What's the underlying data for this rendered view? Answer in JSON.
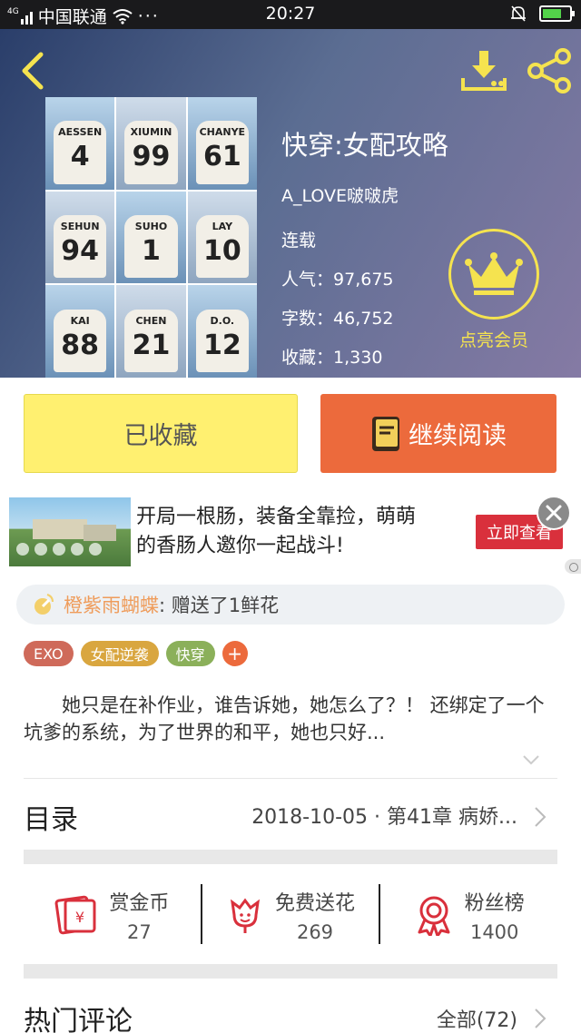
{
  "status_bar": {
    "carrier": "中国联通",
    "network": "4G",
    "time": "20:27"
  },
  "book": {
    "title": "快穿:女配攻略",
    "author": "A_LOVE啵啵虎",
    "status": "连载",
    "popularity_label": "人气",
    "popularity": "97,675",
    "words_label": "字数",
    "words": "46,752",
    "favorites_label": "收藏",
    "favorites": "1,330",
    "cover_jerseys": [
      {
        "name": "AESSEN",
        "no": "4"
      },
      {
        "name": "XIUMIN",
        "no": "99"
      },
      {
        "name": "CHANYE",
        "no": "61"
      },
      {
        "name": "SEHUN",
        "no": "94"
      },
      {
        "name": "SUHO",
        "no": "1"
      },
      {
        "name": "LAY",
        "no": "10"
      },
      {
        "name": "KAI",
        "no": "88"
      },
      {
        "name": "CHEN",
        "no": "21"
      },
      {
        "name": "D.O.",
        "no": "12"
      }
    ]
  },
  "vip": {
    "label": "点亮会员",
    "color": "#f5e34f"
  },
  "actions": {
    "favorited_label": "已收藏",
    "read_label": "继续阅读",
    "read_color": "#ec6a3c",
    "fav_color": "#fff070"
  },
  "ad": {
    "line1": "开局一根肠，装备全靠捡，萌萌",
    "line2": "的香肠人邀你一起战斗!",
    "cta": "立即查看"
  },
  "gift_notice": {
    "user": "橙紫雨蝴蝶",
    "text": ": 赠送了1鲜花"
  },
  "tags": [
    {
      "label": "EXO",
      "color": "#cf6a5a"
    },
    {
      "label": "女配逆袭",
      "color": "#d9a63f"
    },
    {
      "label": "快穿",
      "color": "#8bb05a"
    },
    {
      "label": "+",
      "color": "#ec6a3c"
    }
  ],
  "description": "她只是在补作业，谁告诉她，她怎么了？！ 还绑定了一个坑爹的系统，为了世界的和平，她也只好...",
  "toc": {
    "label": "目录",
    "latest": "2018-10-05 · 第41章  病娇..."
  },
  "stats": [
    {
      "label": "赏金币",
      "value": "27",
      "icon": "red-envelope-icon"
    },
    {
      "label": "免费送花",
      "value": "269",
      "icon": "flower-icon"
    },
    {
      "label": "粉丝榜",
      "value": "1400",
      "icon": "medal-icon"
    }
  ],
  "comments": {
    "label": "热门评论",
    "all_label": "全部(72)"
  }
}
